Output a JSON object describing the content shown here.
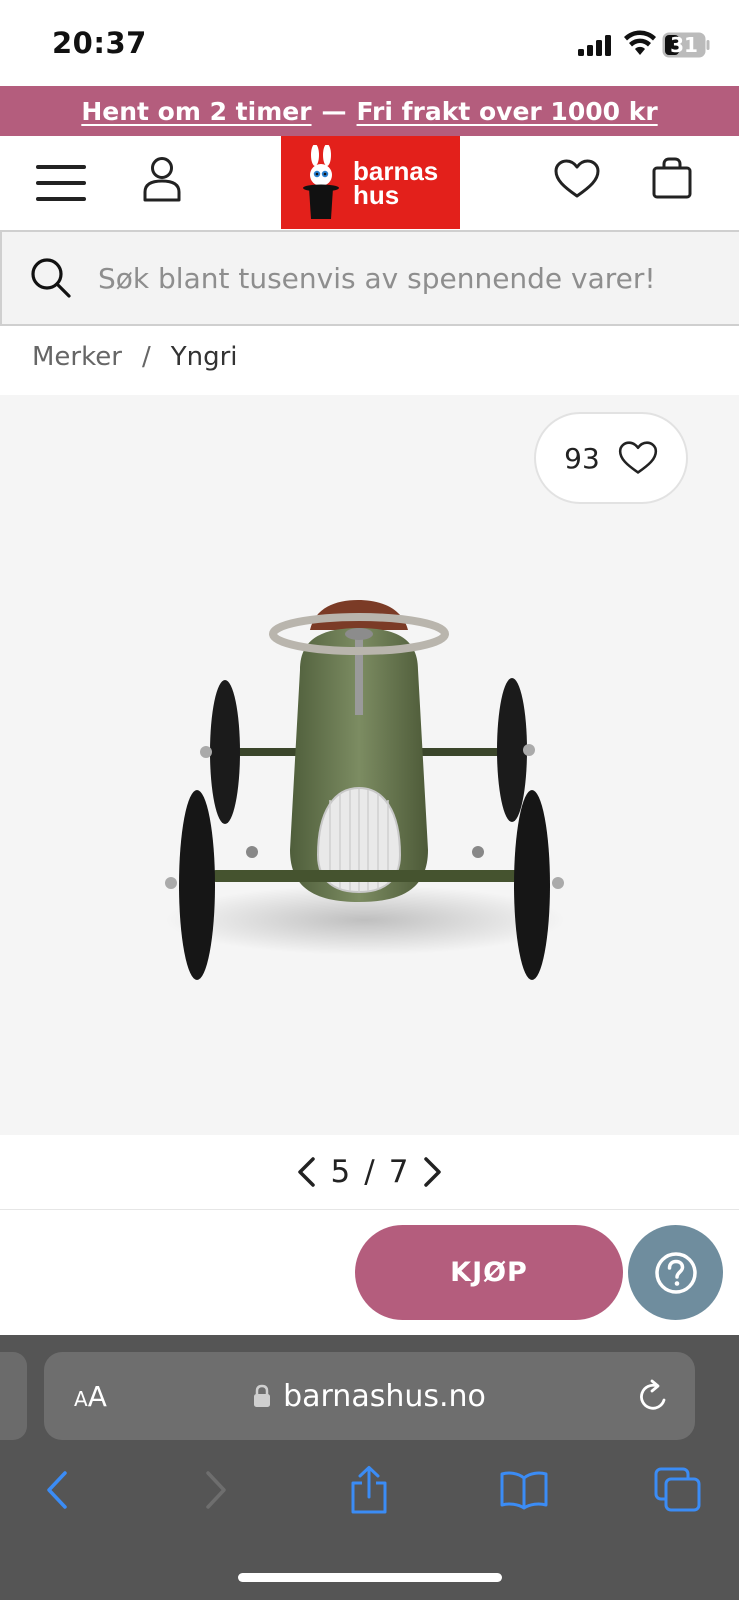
{
  "status_bar": {
    "time": "20:37",
    "battery": "31"
  },
  "promo": {
    "pickup": "Hent om 2 timer",
    "separator": "—",
    "shipping": "Fri frakt over 1000 kr"
  },
  "header": {
    "logo_line1": "barnas",
    "logo_line2": "hus",
    "icons": [
      "menu-icon",
      "user-icon",
      "heart-icon",
      "bag-icon"
    ]
  },
  "search": {
    "placeholder": "Søk blant tusenvis av spennende varer!"
  },
  "breadcrumb": {
    "parent": "Merker",
    "separator": "/",
    "current": "Yngri"
  },
  "gallery": {
    "favorite_count": "93",
    "current": "5",
    "separator": "/",
    "total": "7"
  },
  "actions": {
    "buy_label": "KJØP",
    "help_label": "?"
  },
  "browser": {
    "aa_small": "A",
    "aa_large": "A",
    "url": "barnashus.no"
  },
  "colors": {
    "accent": "#b45d7d",
    "logo_red": "#e3201b",
    "help": "#6f8d9e",
    "ios_blue": "#3b8cf5"
  }
}
